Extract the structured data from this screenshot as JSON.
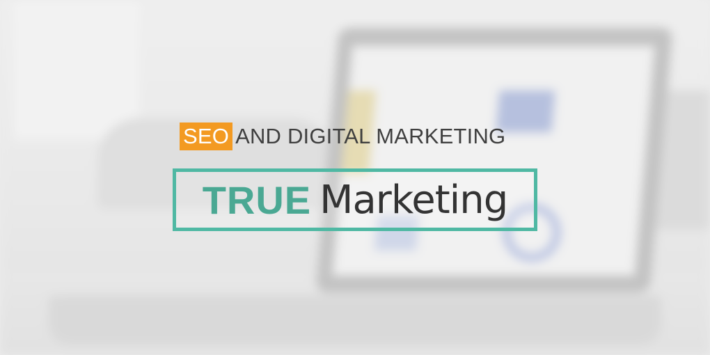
{
  "tagline": {
    "highlight": "SEO",
    "rest": "AND DIGITAL MARKETING"
  },
  "brand": {
    "word1": "TRUE",
    "word2": "Marketing"
  },
  "colors": {
    "highlight_bg": "#f39a22",
    "brand_teal": "#4aa893",
    "frame_teal": "#4fb8a3",
    "text_dark": "#333333"
  },
  "background": {
    "scene": "blurred-laptop-photo"
  }
}
